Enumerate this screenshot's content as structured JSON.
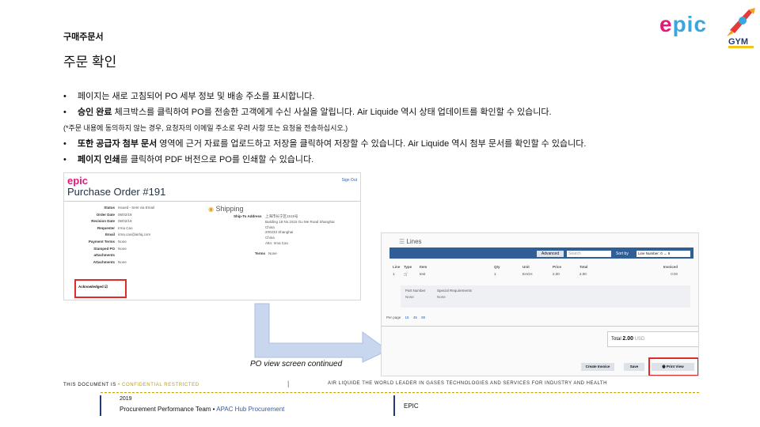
{
  "header": {
    "doc_label": "구매주문서",
    "page_title": "주문 확인",
    "logo_epic_e": "e",
    "logo_epic_pic": "pic",
    "logo_gym": "GYM"
  },
  "bullets": [
    {
      "marker": "•",
      "bold": "",
      "text": "페이지는 새로 고침되어 PO 세부 정보 및 배송 주소를 표시합니다."
    },
    {
      "marker": "•",
      "bold": "승인 완료",
      "text": " 체크박스를 클릭하여 PO를 전송한 고객에게 수신 사실을 알립니다. Air Liquide 역시 상태 업데이트를 확인할 수 있습니다."
    },
    {
      "marker": "",
      "bold": "",
      "text": "(*주문 내용에 동의하지 않는 경우, 요청자의 이메일 주소로 우려 사항 또는 요청을 전송하십시오.)"
    },
    {
      "marker": "•",
      "bold": "또한 공급자 첨부 문서",
      "text": " 영역에 근거 자료를 업로드하고 저장을 클릭하여 저장할 수 있습니다. Air Liquide 역시 첨부 문서를 확인할 수 있습니다."
    },
    {
      "marker": "•",
      "bold": "페이지 인쇄",
      "text": "를 클릭하여 PDF 버전으로 PO를 인쇄할 수 있습니다."
    }
  ],
  "po_screen": {
    "logo": "epic",
    "title": "Purchase Order #191",
    "sign_out": "Sign Out",
    "shipping_heading": "Shipping",
    "fields": [
      {
        "k": "Status",
        "v": "Issued - Sent via Email"
      },
      {
        "k": "Order Date",
        "v": "06/02/19"
      },
      {
        "k": "Revision Date",
        "v": "06/02/19"
      },
      {
        "k": "Requester",
        "v": "Irma Cao"
      },
      {
        "k": "Email",
        "v": "irma.cao@airliq.com"
      },
      {
        "k": "Payment Terms",
        "v": "None"
      },
      {
        "k": "Stamped PO",
        "v": "None"
      },
      {
        "k": "attachments",
        "v": ""
      },
      {
        "k": "Attachments",
        "v": "None"
      }
    ],
    "ship_to_label": "Ship-To Address",
    "ship_lines": [
      "上海市长宁区1515号",
      "Building 18 No.1515 Gu Me Road Shanghai",
      "China",
      "200233 Shanghai",
      "China",
      "Attn: Irma Cao"
    ],
    "terms_label": "Terms",
    "terms_value": "None",
    "acknowledged_label": "Acknowledged",
    "acknowledged_check": "☑"
  },
  "lines_screen": {
    "heading": "Lines",
    "advanced": "Advanced",
    "search_placeholder": "Search",
    "sort_by": "Sort by",
    "sort_value": "Line Number: 0 → 9",
    "columns": [
      "Line",
      "Type",
      "Item",
      "",
      "Qty",
      "Unit",
      "Price",
      "Total",
      "Invoiced"
    ],
    "row": [
      "1",
      "🛒",
      "test",
      "",
      "1",
      "EACH",
      "2.00",
      "2.00",
      "0.00"
    ],
    "detail_headers": [
      "Part Number",
      "Special Requirements"
    ],
    "detail_values": [
      "None",
      "None"
    ],
    "per_page_label": "Per page",
    "per_page_options": [
      "15",
      "45",
      "90"
    ],
    "total_label": "Total",
    "total_value": "2.00",
    "total_currency": "USD",
    "btn_create_invoice": "Create Invoice",
    "btn_save": "Save",
    "btn_print": "🖶 Print View"
  },
  "caption": "PO view screen continued",
  "footer": {
    "left_prefix": "THIS DOCUMENT IS ",
    "left_conf": "• CONFIDENTIAL RESTRICTED",
    "mid_dot": "|",
    "right": "AIR LIQUIDE THE WORLD LEADER IN GASES TECHNOLOGIES AND SERVICES FOR INDUSTRY AND HEALTH",
    "year": "2019",
    "team": "Procurement Performance Team • ",
    "hub": "APAC Hub Procurement",
    "epic": "EPIC"
  }
}
